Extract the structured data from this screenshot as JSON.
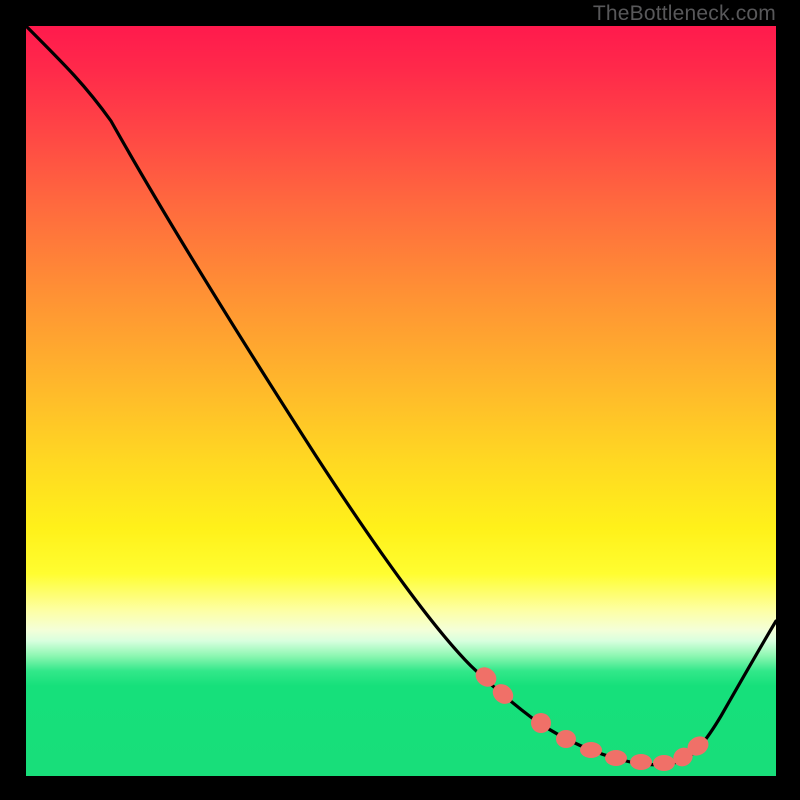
{
  "watermark": "TheBottleneck.com",
  "chart_data": {
    "type": "line",
    "title": "",
    "xlabel": "",
    "ylabel": "",
    "xlim": [
      0,
      100
    ],
    "ylim": [
      0,
      100
    ],
    "series": [
      {
        "name": "bottleneck-curve",
        "x": [
          0,
          5,
          10,
          15,
          20,
          25,
          30,
          35,
          40,
          45,
          50,
          55,
          60,
          63,
          65,
          68,
          70,
          73,
          76,
          80,
          84,
          87,
          88,
          90,
          93,
          96,
          100
        ],
        "y": [
          100,
          97,
          93,
          87,
          80,
          73,
          66,
          59,
          52,
          45,
          38,
          31,
          24,
          18,
          15,
          12,
          10,
          7,
          5,
          3,
          2,
          2,
          3,
          5,
          9,
          13,
          19
        ]
      }
    ],
    "markers": {
      "name": "highlight-points",
      "x": [
        62,
        64,
        69,
        72,
        76,
        79,
        83,
        85,
        87,
        88
      ],
      "y": [
        20,
        17,
        10,
        7,
        4,
        3,
        2,
        2,
        3,
        5
      ]
    },
    "gradient_stops": [
      {
        "pos": 0,
        "color": "#ff1a4d"
      },
      {
        "pos": 50,
        "color": "#ffd822"
      },
      {
        "pos": 78,
        "color": "#fdffa6"
      },
      {
        "pos": 86,
        "color": "#32e88a"
      },
      {
        "pos": 100,
        "color": "#18de7a"
      }
    ]
  }
}
